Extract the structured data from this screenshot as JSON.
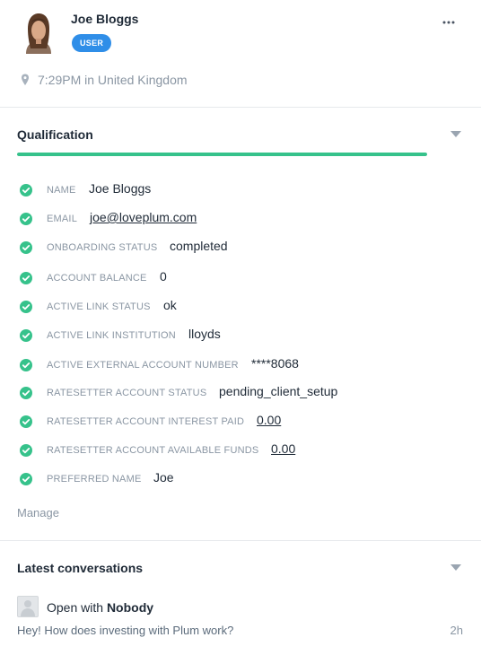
{
  "profile": {
    "name": "Joe Bloggs",
    "badge": "USER",
    "location": "7:29PM in United Kingdom",
    "more_label": "···"
  },
  "qualification": {
    "title": "Qualification",
    "progress_fraction": 1.0,
    "progress_color": "#36c28b",
    "fields": [
      {
        "label": "NAME",
        "value": "Joe Bloggs",
        "link": false
      },
      {
        "label": "EMAIL",
        "value": "joe@loveplum.com",
        "link": true
      },
      {
        "label": "ONBOARDING STATUS",
        "value": "completed",
        "link": false
      },
      {
        "label": "ACCOUNT BALANCE",
        "value": "0",
        "link": false
      },
      {
        "label": "ACTIVE LINK STATUS",
        "value": "ok",
        "link": false
      },
      {
        "label": "ACTIVE LINK INSTITUTION",
        "value": "lloyds",
        "link": false
      },
      {
        "label": "ACTIVE EXTERNAL ACCOUNT NUMBER",
        "value": "****8068",
        "link": false
      },
      {
        "label": "RATESETTER ACCOUNT STATUS",
        "value": "pending_client_setup",
        "link": false
      },
      {
        "label": "RATESETTER ACCOUNT INTEREST PAID",
        "value": "0.00",
        "link": true
      },
      {
        "label": "RATESETTER ACCOUNT AVAILABLE FUNDS",
        "value": "0.00",
        "link": true
      },
      {
        "label": "PREFERRED NAME",
        "value": "Joe",
        "link": false
      }
    ],
    "manage_label": "Manage"
  },
  "conversations": {
    "title": "Latest conversations",
    "items": [
      {
        "status_prefix": "Open with",
        "assignee": "Nobody",
        "message": "Hey! How does investing with Plum work?",
        "time": "2h"
      }
    ]
  },
  "colors": {
    "badge": "#2f8ee8",
    "check": "#36c28b",
    "accent_text": "#1f2a37",
    "muted_text": "#8a96a3"
  },
  "icons": {
    "more": "more-horizontal-icon",
    "location": "map-pin-icon",
    "check": "check-circle-icon",
    "collapse": "caret-down-icon"
  }
}
